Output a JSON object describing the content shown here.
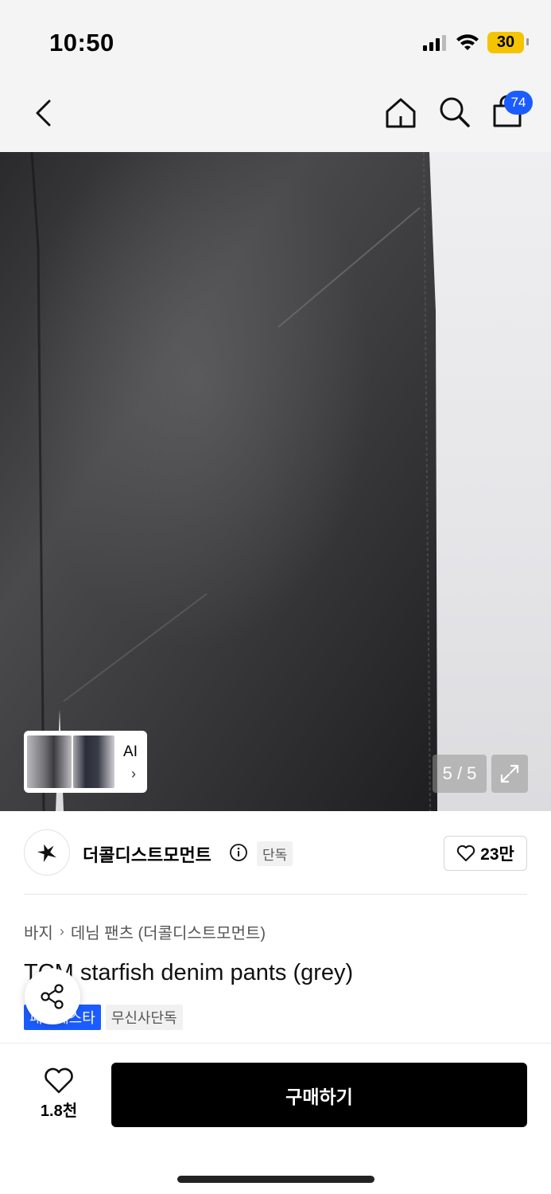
{
  "status_bar": {
    "time": "10:50",
    "battery": "30"
  },
  "nav": {
    "cart_count": "74"
  },
  "gallery": {
    "page_counter": "5 / 5",
    "ai_label": "AI",
    "ai_chevron": "›"
  },
  "brand": {
    "name": "더콜디스트모먼트",
    "exclusive_tag": "단독",
    "likes": "23만"
  },
  "breadcrumb": {
    "category": "바지",
    "subcategory": "데님 팬츠 (더콜디스트모먼트)"
  },
  "product": {
    "title": "TCM starfish denim pants (grey)",
    "tags": [
      "패션페스타",
      "무신사단독"
    ]
  },
  "bottom": {
    "wish_count": "1.8천",
    "buy_label": "구매하기"
  },
  "icons": [
    "chevron-left-icon",
    "home-icon",
    "search-icon",
    "shopping-bag-icon",
    "info-icon",
    "heart-icon",
    "share-icon",
    "expand-icon",
    "starfish-logo-icon"
  ],
  "colors": {
    "accent": "#1a5cff",
    "buy_button": "#000000",
    "battery": "#f5c400"
  }
}
